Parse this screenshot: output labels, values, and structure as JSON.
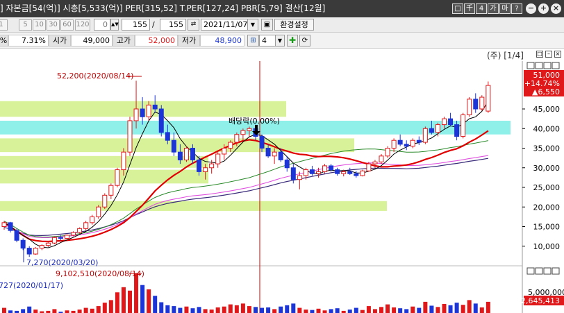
{
  "titlebar": {
    "title": "] 자본금[54(억)] 시총[5,533(억)] PER[315,52] T.PER[127,24] PBR[5,79] 결산[12월]",
    "buttons": [
      "□",
      "千",
      "4",
      "가",
      "마",
      "?"
    ],
    "circle_buttons": [
      "−",
      "+",
      "×"
    ]
  },
  "toolbar1": {
    "periods": [
      "1",
      "5",
      "10",
      "30",
      "60",
      "120"
    ],
    "box0": "0",
    "count_value": "155",
    "slash": "/",
    "count_total": "155",
    "date": "2021/11/07",
    "settings_label": "환경설정"
  },
  "toolbar2": {
    "pct_symbol": "%",
    "rate": "7.31%",
    "open_label": "시가",
    "open_value": "49,000",
    "high_label": "고가",
    "high_value": "52,000",
    "low_label": "저가",
    "low_value": "48,900",
    "grid_value": "4"
  },
  "chart_header": {
    "page": "(주) [1/4]"
  },
  "price_axis": {
    "ticks": [
      "45,000",
      "40,000",
      "35,000",
      "30,000",
      "25,000",
      "20,000",
      "15,000",
      "10,000"
    ],
    "current_price": "51,000",
    "change_pct": "+14.74%",
    "change_amount": "▲6,550"
  },
  "annotations": {
    "high_marker": "52,200(2020/08/14)",
    "low_marker": "7,270(2020/03/20)",
    "dividend": "배당락(0.00%)",
    "vol_high_marker": "9,102,510(2020/08/14)",
    "vol_left_marker": "727(2020/01/17)"
  },
  "volume_axis": {
    "tick": "5,000,000",
    "current_volume": "2,645,413"
  },
  "chart_data": {
    "type": "candlestick",
    "candles": [
      [
        15000,
        16500,
        14200,
        16000
      ],
      [
        16000,
        16200,
        13500,
        14000
      ],
      [
        14000,
        14500,
        11000,
        11500
      ],
      [
        11500,
        12000,
        9000,
        9500
      ],
      [
        9500,
        10000,
        7270,
        8000
      ],
      [
        8000,
        9800,
        7800,
        9500
      ],
      [
        9500,
        10500,
        9000,
        10200
      ],
      [
        10200,
        11000,
        9800,
        10800
      ],
      [
        10800,
        12500,
        10500,
        12200
      ],
      [
        12200,
        12800,
        11500,
        12000
      ],
      [
        12000,
        13000,
        11800,
        12800
      ],
      [
        12800,
        13800,
        12500,
        13500
      ],
      [
        13500,
        14800,
        13200,
        14500
      ],
      [
        14500,
        16500,
        14000,
        16000
      ],
      [
        16000,
        18000,
        15500,
        17500
      ],
      [
        17500,
        20500,
        17000,
        20000
      ],
      [
        20000,
        23500,
        19500,
        23000
      ],
      [
        23000,
        26000,
        22000,
        25500
      ],
      [
        25500,
        30000,
        25000,
        29500
      ],
      [
        29500,
        35000,
        28000,
        34000
      ],
      [
        34000,
        43000,
        33000,
        42000
      ],
      [
        42000,
        52200,
        40000,
        45000
      ],
      [
        45000,
        48000,
        41000,
        43000
      ],
      [
        43000,
        47000,
        42000,
        46000
      ],
      [
        46000,
        48500,
        44000,
        45000
      ],
      [
        45000,
        46000,
        38000,
        39000
      ],
      [
        39000,
        41000,
        36000,
        37000
      ],
      [
        37000,
        39000,
        33000,
        34000
      ],
      [
        34000,
        36000,
        31000,
        32000
      ],
      [
        32000,
        35500,
        31500,
        35000
      ],
      [
        35000,
        36000,
        31000,
        32000
      ],
      [
        32000,
        33000,
        28000,
        29000
      ],
      [
        29000,
        31000,
        27000,
        30000
      ],
      [
        30000,
        32000,
        28500,
        31000
      ],
      [
        31000,
        34000,
        30000,
        33500
      ],
      [
        33500,
        36000,
        32000,
        35000
      ],
      [
        35000,
        37000,
        34000,
        36500
      ],
      [
        36500,
        39000,
        35500,
        38500
      ],
      [
        38500,
        40000,
        37000,
        39500
      ],
      [
        39500,
        40500,
        38000,
        40000
      ],
      [
        40000,
        41000,
        37000,
        38000
      ],
      [
        38000,
        38500,
        34000,
        35000
      ],
      [
        35000,
        36000,
        32500,
        33000
      ],
      [
        33000,
        35000,
        31000,
        34000
      ],
      [
        34000,
        35000,
        31500,
        32000
      ],
      [
        32000,
        33000,
        29000,
        30000
      ],
      [
        30000,
        31000,
        26000,
        27000
      ],
      [
        27000,
        29000,
        24500,
        28000
      ],
      [
        28000,
        30000,
        27000,
        29500
      ],
      [
        29500,
        30500,
        28000,
        28500
      ],
      [
        28500,
        30000,
        27500,
        29000
      ],
      [
        29000,
        31000,
        28500,
        30500
      ],
      [
        30500,
        31000,
        29000,
        29500
      ],
      [
        29500,
        30000,
        28000,
        28500
      ],
      [
        28500,
        29500,
        27800,
        29000
      ],
      [
        29000,
        30000,
        28200,
        28500
      ],
      [
        28500,
        29200,
        27500,
        28000
      ],
      [
        28000,
        29500,
        27800,
        29200
      ],
      [
        29200,
        31500,
        29000,
        31000
      ],
      [
        31000,
        32000,
        30000,
        31500
      ],
      [
        31500,
        33500,
        31000,
        33000
      ],
      [
        33000,
        35500,
        32500,
        35000
      ],
      [
        35000,
        37500,
        34000,
        37000
      ],
      [
        37000,
        38500,
        35500,
        36000
      ],
      [
        36000,
        37000,
        34500,
        35500
      ],
      [
        35500,
        37500,
        35000,
        37000
      ],
      [
        37000,
        38000,
        35800,
        36500
      ],
      [
        36500,
        40500,
        36000,
        40000
      ],
      [
        40000,
        42000,
        38500,
        39000
      ],
      [
        39000,
        41500,
        38000,
        41000
      ],
      [
        41000,
        43000,
        40000,
        42500
      ],
      [
        42500,
        44000,
        40500,
        41000
      ],
      [
        41000,
        42000,
        37000,
        38000
      ],
      [
        38000,
        44000,
        37500,
        43500
      ],
      [
        43500,
        48000,
        43000,
        47500
      ],
      [
        47500,
        49000,
        44000,
        45000
      ],
      [
        45000,
        48500,
        44500,
        48000
      ],
      [
        44450,
        52000,
        44000,
        51000
      ]
    ],
    "zones": [
      [
        43000,
        47000
      ],
      [
        38500,
        42000
      ],
      [
        34000,
        37500
      ],
      [
        30000,
        33000
      ],
      [
        26000,
        29500
      ],
      [
        19000,
        21500
      ]
    ],
    "volumes": [
      1.2,
      0.6,
      0.5,
      0.9,
      1.5,
      0.8,
      0.4,
      0.5,
      0.9,
      0.3,
      0.6,
      0.5,
      0.8,
      1.2,
      1.0,
      1.6,
      2.4,
      3.0,
      4.8,
      6.0,
      5.2,
      9.1,
      6.5,
      5.5,
      4.0,
      2.5,
      1.8,
      1.6,
      1.2,
      1.5,
      1.1,
      1.4,
      0.9,
      0.8,
      1.3,
      1.5,
      2.0,
      1.8,
      2.2,
      1.6,
      1.4,
      1.2,
      1.3,
      0.9,
      1.5,
      1.8,
      2.2,
      1.2,
      0.8,
      0.7,
      1.0,
      0.6,
      0.9,
      1.1,
      0.5,
      0.8,
      1.2,
      0.7,
      1.6,
      0.9,
      1.4,
      2.0,
      1.3,
      1.1,
      0.9,
      1.5,
      1.2,
      2.6,
      1.7,
      1.4,
      2.1,
      1.8,
      2.4,
      1.9,
      3.0,
      2.2,
      1.3,
      2.6
    ]
  },
  "colors": {
    "up": "#e0181a",
    "down": "#1c35d6",
    "ma5": "#000000",
    "ma20": "#e00000",
    "ma60": "#2a8a2a",
    "ma120": "#e050e0",
    "ma240": "#3a2a7a",
    "zone": "#d8f29a",
    "zone_cyan": "#8ff0ea",
    "vline": "#d00000"
  }
}
